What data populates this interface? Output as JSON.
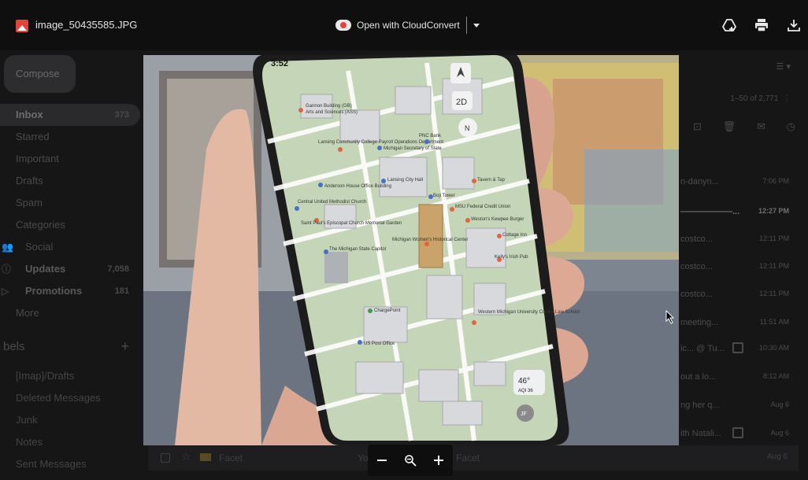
{
  "viewer": {
    "file_name": "image_50435585.JPG",
    "open_with_label": "Open with CloudConvert",
    "icons": [
      "add-to-drive-icon",
      "print-icon",
      "download-icon",
      "zoom-out-icon",
      "zoom-reset-icon",
      "zoom-in-icon"
    ]
  },
  "gmail": {
    "compose_label": "Compose",
    "nav": [
      {
        "label": "Inbox",
        "count": "373"
      },
      {
        "label": "Starred",
        "count": ""
      },
      {
        "label": "Important",
        "count": ""
      },
      {
        "label": "Drafts",
        "count": ""
      },
      {
        "label": "Spam",
        "count": ""
      },
      {
        "label": "Categories",
        "count": ""
      },
      {
        "label": "Social",
        "count": ""
      },
      {
        "label": "Updates",
        "count": "7,058"
      },
      {
        "label": "Promotions",
        "count": "181"
      },
      {
        "label": "More",
        "count": ""
      }
    ],
    "labels_heading": "bels",
    "labels_add": "+",
    "labels": [
      "[Imap]/Drafts",
      "Deleted Messages",
      "Junk",
      "Notes",
      "Sent Messages"
    ],
    "range_text": "1–50 of 2,771",
    "mail_rows": [
      {
        "snippet": "n-danyn...",
        "time": "7:06 PM"
      },
      {
        "snippet": "——————...",
        "time": "12:27 PM"
      },
      {
        "snippet": "costco...",
        "time": "12:11 PM"
      },
      {
        "snippet": "costco...",
        "time": "12:11 PM"
      },
      {
        "snippet": "costco...",
        "time": "12:11 PM"
      },
      {
        "snippet": "meeting...",
        "time": "11:51 AM"
      },
      {
        "snippet": "ic... @ Tu...",
        "time": "10:30 AM"
      },
      {
        "snippet": "out a lo...",
        "time": "8:12 AM"
      },
      {
        "snippet": "ng her q...",
        "time": "Aug 6"
      },
      {
        "snippet": "ith Natali...",
        "time": "Aug 6"
      }
    ],
    "bottom_row": {
      "sender": "Facet",
      "message": "Yo... been opened with Facet",
      "date": "Aug 6"
    }
  },
  "photo": {
    "time": "3:52",
    "map_2d": "2D",
    "compass": "N",
    "temp": "46°",
    "aqi": "AQI 36",
    "avatar": "JF",
    "places": [
      "Gannon Building (GB)",
      "Arts and Sciences (ASS)",
      "Lansing Community College Payroll Operations Department",
      "Michigan Secretary of State",
      "PNC Bank",
      "Lansing City Hall",
      "Anderson House Office Building",
      "Central United Methodist Church",
      "Saint Paul's Episcopal Church Memorial Garden",
      "Boji Tower",
      "MSU Federal Credit Union",
      "Weston's Kewpee Burger",
      "Michigan Women's Historical Center",
      "The Michigan State Capitol",
      "ChargePoint",
      "US Post Office",
      "Western Michigan University Cooley Law School",
      "Tavern & Tap",
      "Kelly's Irish Pub",
      "Cottage Inn"
    ]
  }
}
